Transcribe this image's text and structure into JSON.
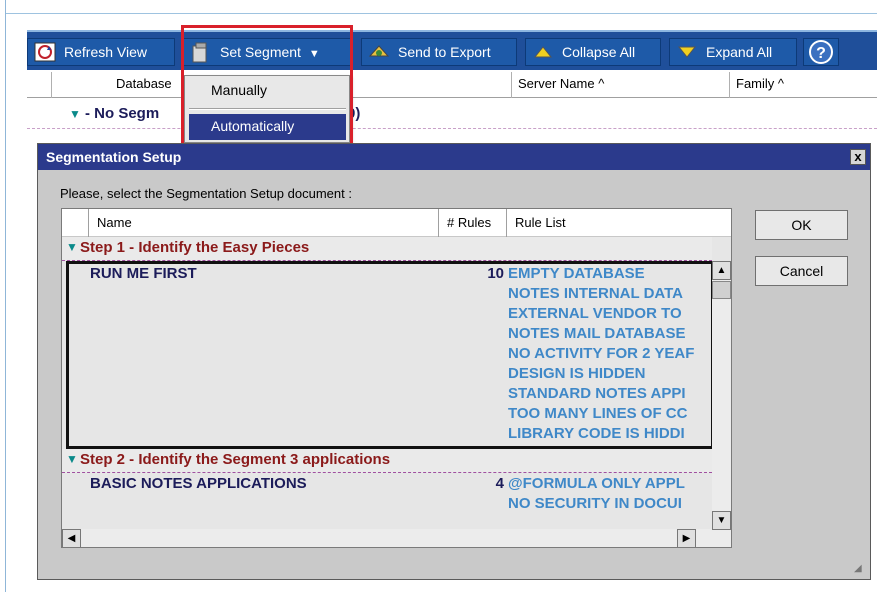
{
  "toolbar": {
    "refresh_label": "Refresh View",
    "set_segment_label": "Set Segment",
    "send_export_label": "Send to Export",
    "collapse_label": "Collapse All",
    "expand_label": "Expand All",
    "help_label": "?"
  },
  "grid": {
    "col_database": "Database",
    "col_server": "Server Name ^",
    "col_family": "Family ^",
    "group_label": "- No Segm",
    "group_suffix": "0)"
  },
  "dropdown": {
    "items": [
      "Manually",
      "Automatically"
    ],
    "selected_index": 1
  },
  "dialog": {
    "title": "Segmentation Setup",
    "close": "x",
    "prompt": "Please, select the Segmentation Setup document :",
    "columns": {
      "name": "Name",
      "rules": "# Rules",
      "rule_list": "Rule List"
    },
    "steps": [
      {
        "title": "Step 1 - Identify the Easy Pieces",
        "entry": "RUN ME FIRST",
        "count": "10",
        "rules": [
          "EMPTY DATABASE",
          "NOTES INTERNAL DATA",
          "EXTERNAL VENDOR TO",
          "NOTES MAIL DATABASE",
          "NO ACTIVITY FOR 2 YEAF",
          "DESIGN IS HIDDEN",
          "STANDARD NOTES APPI",
          "TOO MANY LINES OF CC",
          "LIBRARY CODE IS HIDDI"
        ]
      },
      {
        "title": "Step 2 - Identify the Segment 3 applications",
        "entry": "BASIC NOTES APPLICATIONS",
        "count": "4",
        "rules": [
          "@FORMULA ONLY APPL",
          "NO SECURITY IN DOCUI"
        ]
      }
    ],
    "ok_label": "OK",
    "cancel_label": "Cancel"
  },
  "colors": {
    "toolbar": "#1f4f9a",
    "title_bar": "#2b3a8c",
    "highlight": "#d9202a",
    "rule_text": "#3f88c8",
    "step_text": "#8b1a1a"
  }
}
